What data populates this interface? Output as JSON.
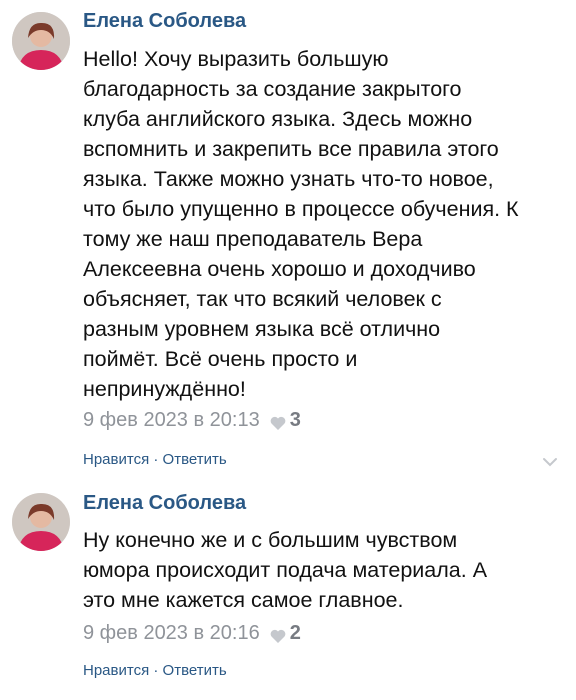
{
  "comments": [
    {
      "author": "Елена Соболева",
      "lines": [
        "Hello! Хочу выразить большую",
        "благодарность за создание закрытого",
        "клуба английского языка. Здесь можно",
        "вспомнить и закрепить все правила этого",
        "языка. Также можно узнать что-то новое,",
        "что было упущенно в процессе обучения. К",
        "тому же наш преподаватель Вера",
        "Алексеевна очень хорошо и доходчиво",
        "объясняет, так что всякий человек с",
        "разным уровнем языка всё отлично",
        "поймёт. Всё очень просто и",
        "непринуждённо!"
      ],
      "date": "9 фев 2023 в 20:13",
      "likes": "3",
      "like_label": "Нравится",
      "separator": "·",
      "reply_label": "Ответить"
    },
    {
      "author": "Елена Соболева",
      "lines": [
        "Ну конечно же и с большим чувством",
        "юмора происходит подача материала. А",
        "это мне кажется самое главное."
      ],
      "date": "9 фев 2023 в 20:16",
      "likes": "2",
      "like_label": "Нравится",
      "separator": "·",
      "reply_label": "Ответить"
    }
  ],
  "icons": {
    "heart": "heart-icon",
    "chevron": "chevron-down-icon",
    "avatar": "avatar"
  },
  "colors": {
    "author": "#2a5885",
    "meta": "#8f9399",
    "link": "#2a5885"
  }
}
